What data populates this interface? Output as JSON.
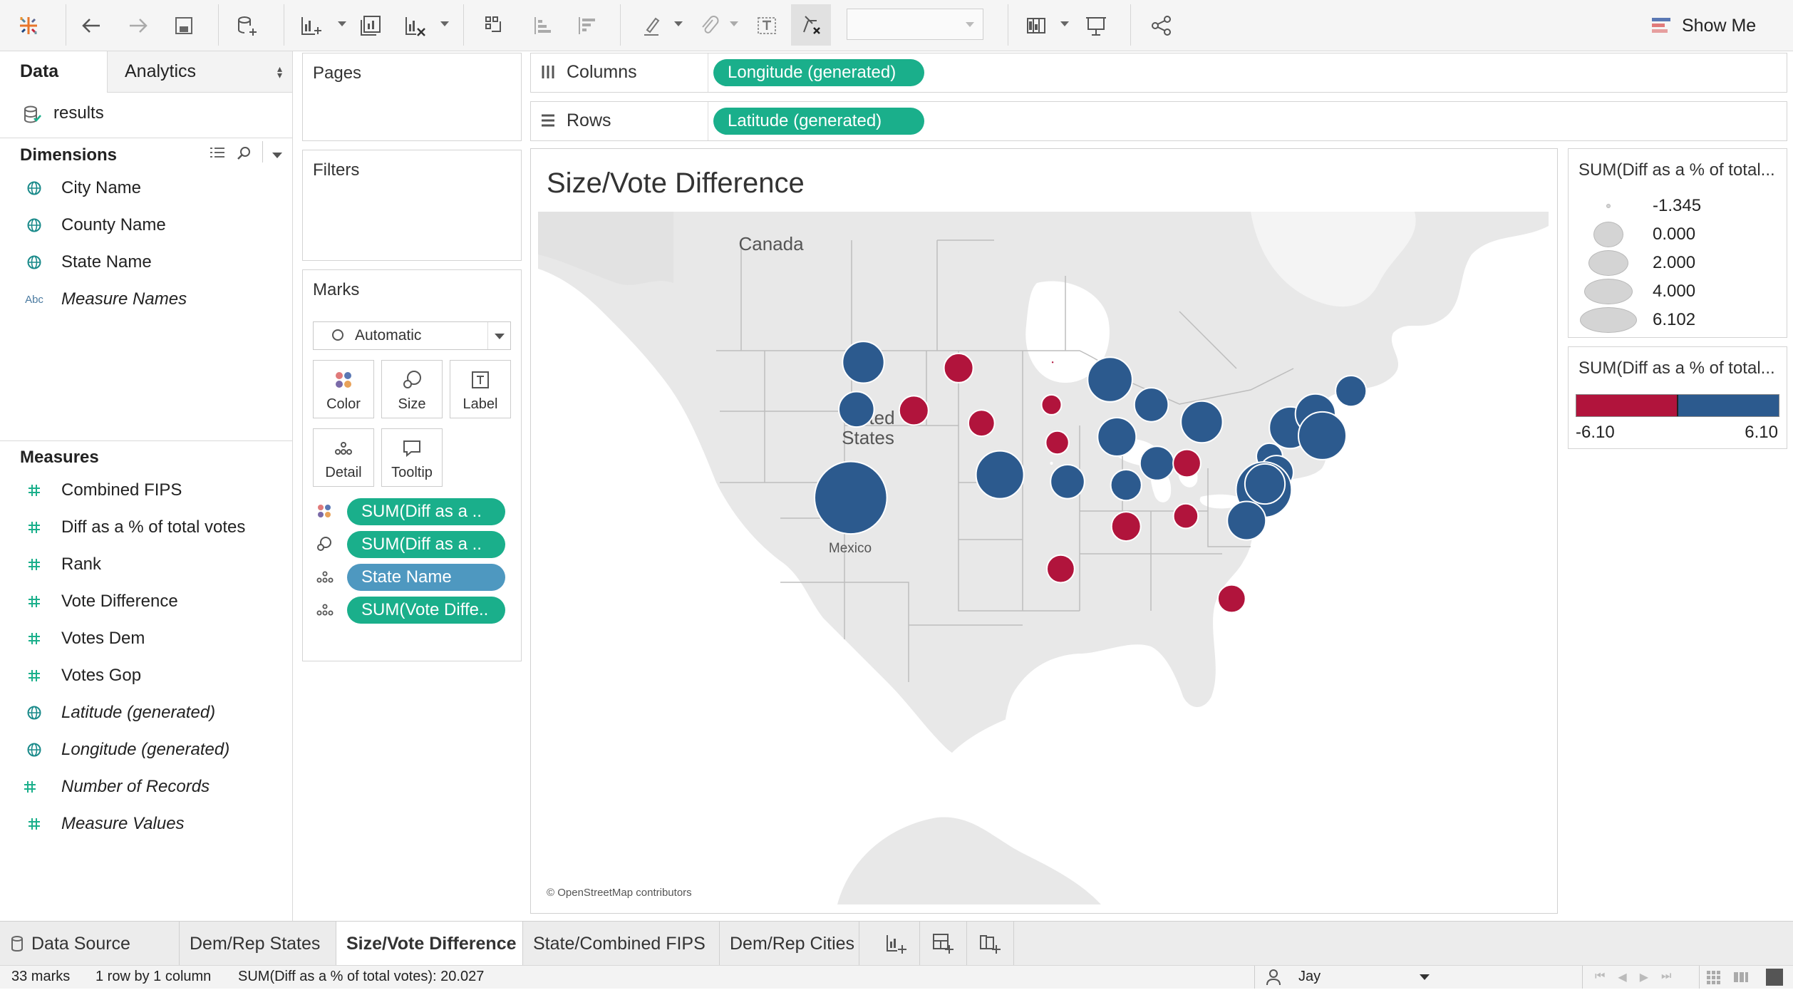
{
  "toolbar": {
    "show_me": "Show Me"
  },
  "left": {
    "tab_data": "Data",
    "tab_analytics": "Analytics",
    "datasource": "results",
    "dimensions_header": "Dimensions",
    "dimensions": [
      {
        "label": "City Name",
        "icon": "globe-icon",
        "italic": false
      },
      {
        "label": "County Name",
        "icon": "globe-icon",
        "italic": false
      },
      {
        "label": "State Name",
        "icon": "globe-icon",
        "italic": false
      },
      {
        "label": "Measure Names",
        "icon": "abc-icon",
        "icon_text": "Abc",
        "italic": true
      }
    ],
    "measures_header": "Measures",
    "measures": [
      {
        "label": "Combined FIPS",
        "icon": "hash-icon",
        "italic": false
      },
      {
        "label": "Diff as a % of total votes",
        "icon": "hash-icon",
        "italic": false
      },
      {
        "label": "Rank",
        "icon": "hash-icon",
        "italic": false
      },
      {
        "label": "Vote Difference",
        "icon": "hash-icon",
        "italic": false
      },
      {
        "label": "Votes Dem",
        "icon": "hash-icon",
        "italic": false
      },
      {
        "label": "Votes Gop",
        "icon": "hash-icon",
        "italic": false
      },
      {
        "label": "Latitude (generated)",
        "icon": "globe-icon",
        "italic": true
      },
      {
        "label": "Longitude (generated)",
        "icon": "globe-icon",
        "italic": true
      },
      {
        "label": "Number of Records",
        "icon": "hash-icon",
        "italic": true
      },
      {
        "label": "Measure Values",
        "icon": "hash-icon",
        "italic": true
      }
    ]
  },
  "shelves": {
    "pages": "Pages",
    "filters": "Filters",
    "columns_label": "Columns",
    "columns_pill": "Longitude (generated)",
    "rows_label": "Rows",
    "rows_pill": "Latitude (generated)"
  },
  "marks": {
    "title": "Marks",
    "type": "Automatic",
    "buttons": [
      "Color",
      "Size",
      "Label",
      "Detail",
      "Tooltip"
    ],
    "pills": [
      {
        "icon": "color-dots-icon",
        "label": "SUM(Diff as a .."
      },
      {
        "icon": "size-icon",
        "label": "SUM(Diff as a .."
      },
      {
        "icon": "detail-icon",
        "label": "State Name"
      },
      {
        "icon": "detail-icon",
        "label": "SUM(Vote Diffe.."
      }
    ]
  },
  "view": {
    "title": "Size/Vote Difference",
    "labels": {
      "canada": "Canada",
      "us_a": "United",
      "us_b": "States",
      "mexico": "Mexico"
    },
    "attribution": "© OpenStreetMap contributors",
    "colors": {
      "dem": "#2c5a8e",
      "gop": "#b1143c",
      "land": "#e8e8e8",
      "water": "#ffffff"
    }
  },
  "legend_size": {
    "title": "SUM(Diff as a % of total...",
    "items": [
      "-1.345",
      "0.000",
      "2.000",
      "4.000",
      "6.102"
    ]
  },
  "legend_color": {
    "title": "SUM(Diff as a % of total...",
    "min": "-6.10",
    "max": "6.10",
    "colors": [
      "#b1143c",
      "#2c5a8e"
    ]
  },
  "sheet_tabs": {
    "data_source": "Data Source",
    "tabs": [
      "Dem/Rep States",
      "Size/Vote Difference",
      "State/Combined FIPS",
      "Dem/Rep Cities"
    ],
    "active": "Size/Vote Difference"
  },
  "status": {
    "marks": "33 marks",
    "rows_cols": "1 row by 1 column",
    "sum": "SUM(Diff as a % of total votes): 20.027",
    "user": "Jay"
  }
}
